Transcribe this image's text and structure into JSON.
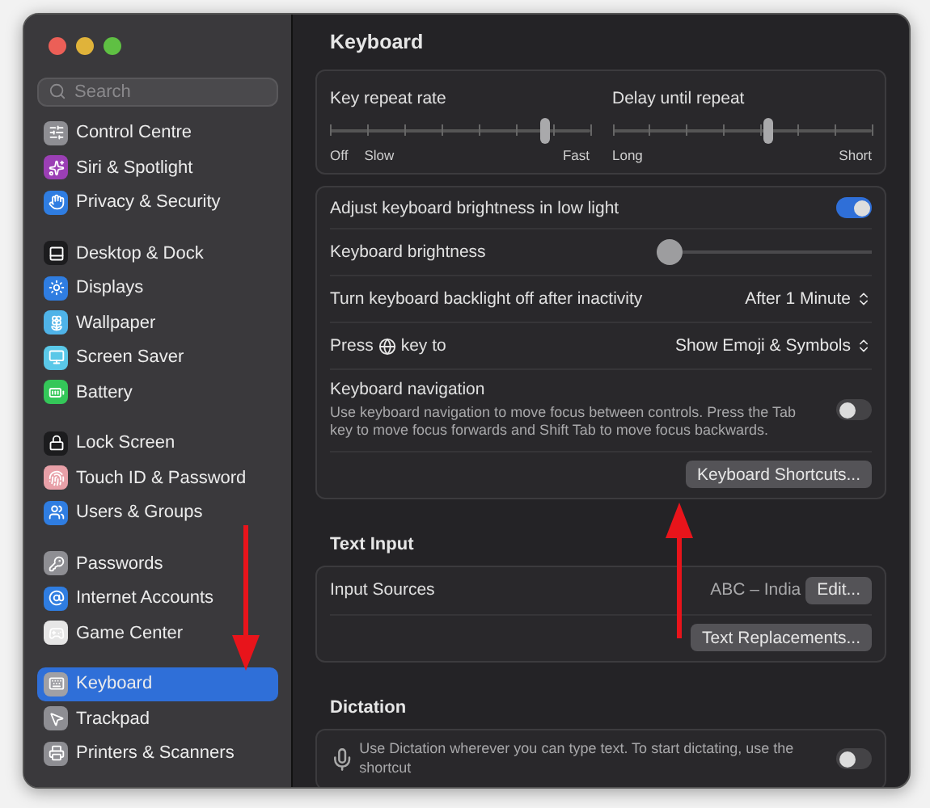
{
  "sidebar": {
    "search": {
      "placeholder": "Search"
    },
    "groups": [
      {
        "items": [
          {
            "label": "Control Centre",
            "color": "#8e8e93",
            "selected": false
          },
          {
            "label": "Siri & Spotlight",
            "color": "#9b3fb5",
            "selected": false
          },
          {
            "label": "Privacy & Security",
            "color": "#2f7de1",
            "selected": false
          }
        ]
      },
      {
        "items": [
          {
            "label": "Desktop & Dock",
            "color": "#1c1c1e",
            "selected": false
          },
          {
            "label": "Displays",
            "color": "#2f7de1",
            "selected": false
          },
          {
            "label": "Wallpaper",
            "color": "#4fb3e8",
            "selected": false
          },
          {
            "label": "Screen Saver",
            "color": "#5ac8e8",
            "selected": false
          },
          {
            "label": "Battery",
            "color": "#34c759",
            "selected": false
          }
        ]
      },
      {
        "items": [
          {
            "label": "Lock Screen",
            "color": "#1c1c1e",
            "selected": false
          },
          {
            "label": "Touch ID & Password",
            "color": "#e8a0a8",
            "selected": false
          },
          {
            "label": "Users & Groups",
            "color": "#2f7de1",
            "selected": false
          }
        ]
      },
      {
        "items": [
          {
            "label": "Passwords",
            "color": "#8e8e93",
            "selected": false
          },
          {
            "label": "Internet Accounts",
            "color": "#2f7de1",
            "selected": false
          },
          {
            "label": "Game Center",
            "color": "#e6e6e6",
            "selected": false
          }
        ]
      },
      {
        "items": [
          {
            "label": "Keyboard",
            "color": "#a0a0a5",
            "selected": true
          },
          {
            "label": "Trackpad",
            "color": "#8e8e93",
            "selected": false
          },
          {
            "label": "Printers & Scanners",
            "color": "#8e8e93",
            "selected": false
          }
        ]
      }
    ]
  },
  "main": {
    "title": "Keyboard",
    "repeat_sliders": [
      {
        "label": "Key repeat rate",
        "level": 0.83,
        "left_labels": [
          "Off",
          "Slow"
        ],
        "right_label": "Fast"
      },
      {
        "label": "Delay until repeat",
        "level": 0.6,
        "left_labels": [
          "Long"
        ],
        "right_label": "Short"
      }
    ],
    "settings": [
      {
        "kind": "toggle",
        "label": "Adjust keyboard brightness in low light",
        "on": true
      },
      {
        "kind": "slider",
        "label": "Keyboard brightness",
        "level": 0
      },
      {
        "kind": "select",
        "label": "Turn keyboard backlight off after inactivity",
        "value": "After 1 Minute"
      },
      {
        "kind": "globe_select",
        "label_start": "Press",
        "label_end": "key to",
        "value": "Show Emoji & Symbols"
      },
      {
        "kind": "toggle",
        "label": "Keyboard navigation",
        "description": "Use keyboard navigation to move focus between controls. Press the Tab key to move focus forwards and Shift Tab to move focus backwards.",
        "on": false
      },
      {
        "kind": "button",
        "button": "Keyboard Shortcuts..."
      }
    ],
    "text_input": {
      "title": "Text Input",
      "rows": [
        {
          "kind": "value_button",
          "label": "Input Sources",
          "value": "ABC – India",
          "button": "Edit..."
        },
        {
          "kind": "button",
          "button": "Text Replacements..."
        }
      ]
    },
    "dictation": {
      "title": "Dictation",
      "description": "Use Dictation wherever you can type text. To start dictating, use the shortcut",
      "on": false
    }
  }
}
